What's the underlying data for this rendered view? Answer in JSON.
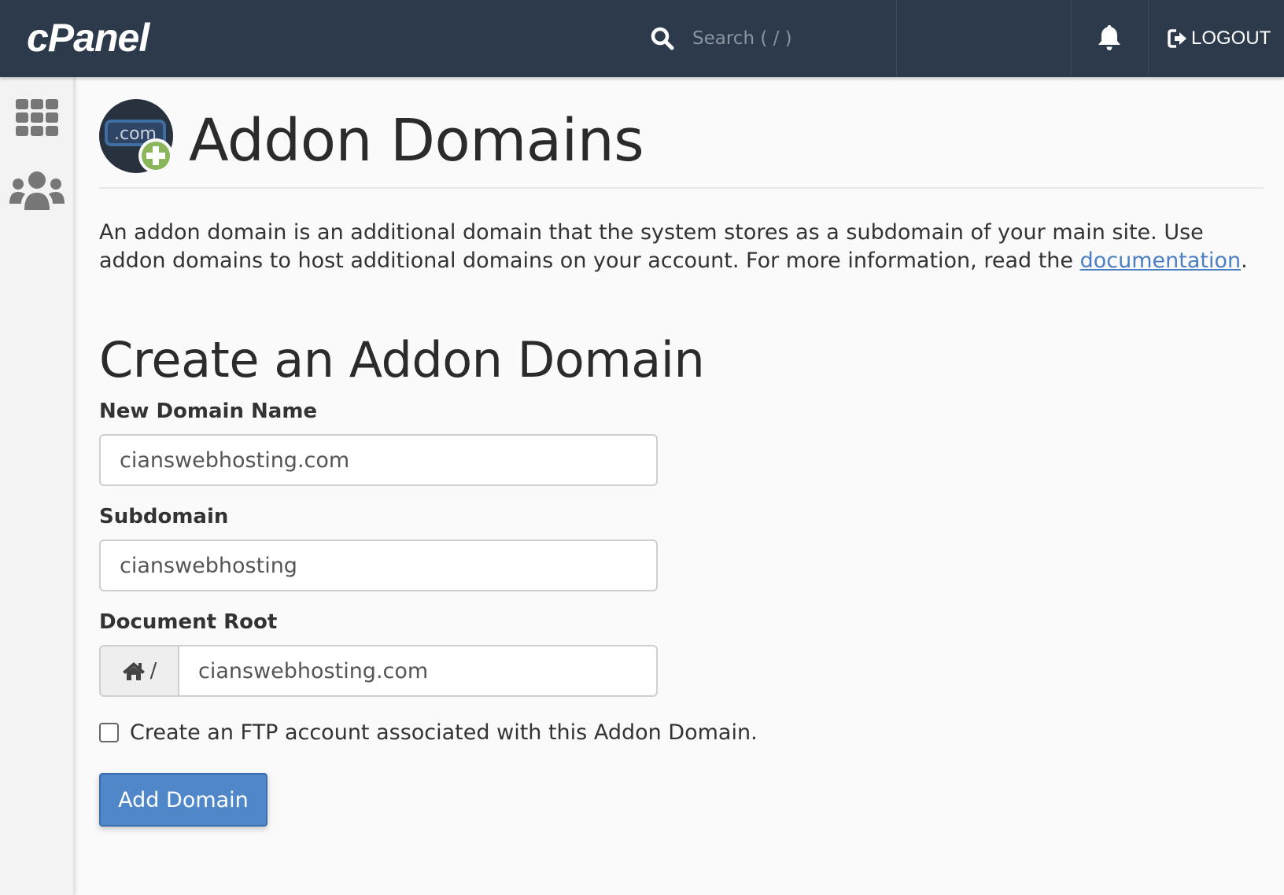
{
  "topbar": {
    "logo_text": "cPanel",
    "search_placeholder": "Search ( / )",
    "logout_label": "LOGOUT",
    "colors": {
      "background": "#2d3a4b"
    }
  },
  "sidebar": {
    "items": [
      {
        "icon": "grid-icon",
        "label": "Tools"
      },
      {
        "icon": "users-icon",
        "label": "Users"
      }
    ]
  },
  "page": {
    "title": "Addon Domains",
    "icon_text": ".com",
    "description_prefix": "An addon domain is an additional domain that the system stores as a subdomain of your main site. Use addon domains to host additional domains on your account. For more information, read the ",
    "description_link": "documentation",
    "description_suffix": "."
  },
  "form": {
    "section_title": "Create an Addon Domain",
    "new_domain": {
      "label": "New Domain Name",
      "value": "cianswebhosting.com"
    },
    "subdomain": {
      "label": "Subdomain",
      "value": "cianswebhosting"
    },
    "document_root": {
      "label": "Document Root",
      "prefix": "/",
      "value": "cianswebhosting.com"
    },
    "ftp_checkbox": {
      "label": "Create an FTP account associated with this Addon Domain.",
      "checked": false
    },
    "submit_label": "Add Domain",
    "colors": {
      "button": "#4f87c9",
      "link": "#4a7fc4",
      "plus_badge": "#8ab55b"
    }
  }
}
